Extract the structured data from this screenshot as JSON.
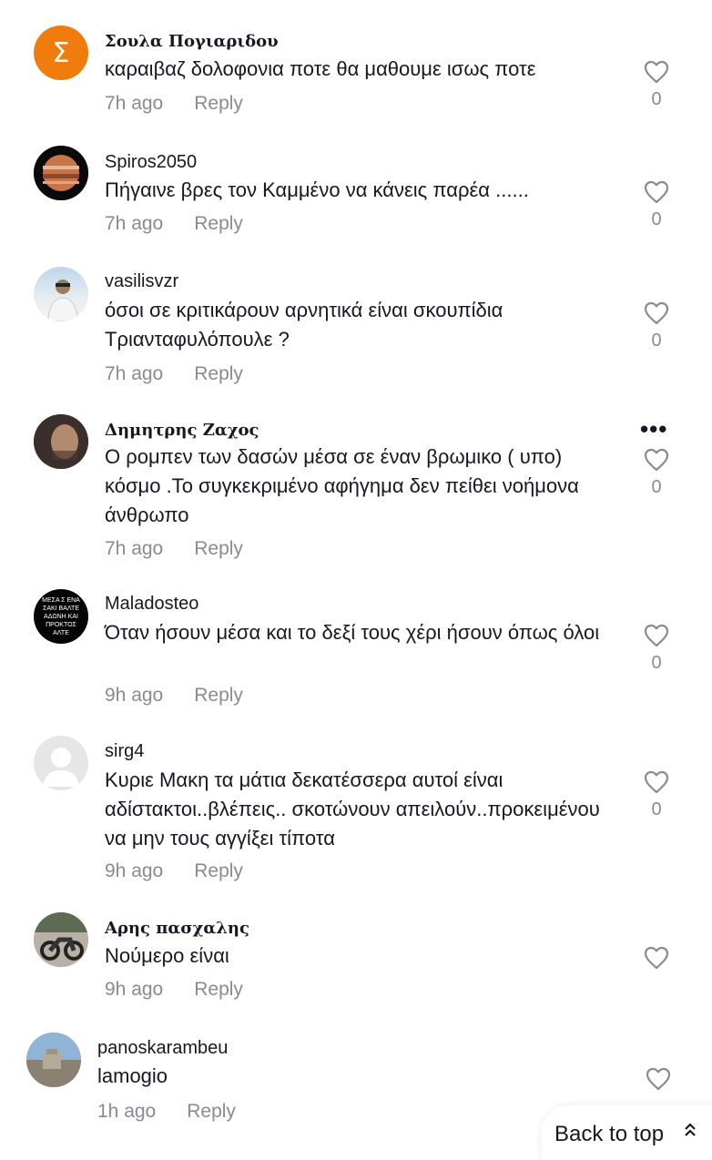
{
  "comments": [
    {
      "avatar_letter": "Σ",
      "username": "Σουλα Πογιαριδου",
      "text": "καραιβαζ δολοφονια ποτε θα μαθουμε ισως ποτε",
      "time": "7h ago",
      "reply": "Reply",
      "likes": "0"
    },
    {
      "username": "Spiros2050",
      "text": "Πήγαινε βρες τον Καμμένο να κάνεις παρέα ......",
      "time": "7h ago",
      "reply": "Reply",
      "likes": "0"
    },
    {
      "username": "vasilisvzr",
      "text": "όσοι σε κριτικάρουν αρνητικά είναι σκουπίδια Τριανταφυλόπουλε ?",
      "time": "7h ago",
      "reply": "Reply",
      "likes": "0"
    },
    {
      "username": "Δημητρης Ζαχος",
      "text": "Ο ρομπεν των δασών μέσα σε έναν βρωμικο ( υπο) κόσμο .Το συγκεκριμένο αφήγημα δεν πείθει νοήμονα άνθρωπο",
      "time": "7h ago",
      "reply": "Reply",
      "likes": "0",
      "more": "•••"
    },
    {
      "avatar_text": "ΜΕΣΑ Σ ΕΝΑ ΣΑΚΙ ΒΑΛΤΕ ΑΔΩΝΗ ΚΑΙ ΠΡΟΚΤΟΣ ΑΛΤΕ",
      "username": "Maladosteo",
      "text": "Όταν ήσουν μέσα και το δεξί τους χέρι ήσουν όπως όλοι",
      "time": "9h ago",
      "reply": "Reply",
      "likes": "0"
    },
    {
      "username": "sirg4",
      "text": "Κυριε Μακη τα μάτια δεκατέσσερα αυτοί είναι αδίστακτοι..βλέπεις.. σκοτώνουν απειλούν..προκειμένου να μην τους αγγίξει τίποτα",
      "time": "9h ago",
      "reply": "Reply",
      "likes": "0"
    },
    {
      "username": "Αρης πασχαλης",
      "text": "Νούμερο είναι",
      "time": "9h ago",
      "reply": "Reply",
      "likes": ""
    },
    {
      "username": "panoskarambeu",
      "text": "lamogio",
      "time": "1h ago",
      "reply": "Reply",
      "likes": ""
    }
  ],
  "back_to_top": "Back to top",
  "colors": {
    "accent_orange": "#f07c0e",
    "muted": "#8a8b91",
    "text": "#161823"
  }
}
